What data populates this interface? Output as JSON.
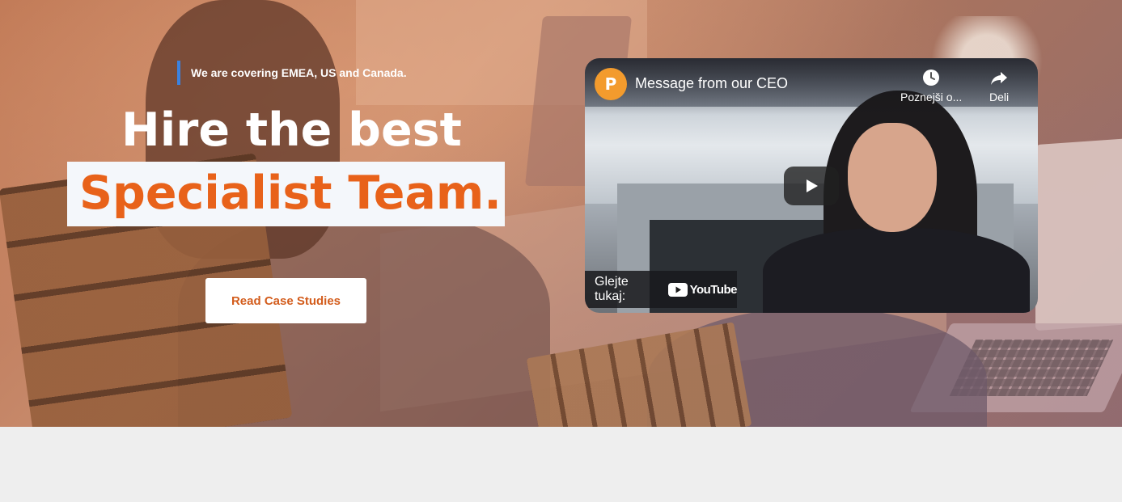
{
  "hero": {
    "tagline": "We are covering EMEA, US and Canada.",
    "headline_line1": "Hire the best",
    "headline_line2": "Specialist Team.",
    "cta_label": "Read Case Studies"
  },
  "video": {
    "channel_logo_letter": "P",
    "title": "Message from our CEO",
    "watch_later_label": "Poznejši o...",
    "share_label": "Deli",
    "watch_on_label": "Glejte tukaj:",
    "platform_label": "YouTube"
  },
  "colors": {
    "accent_orange": "#e8621a",
    "tagline_bar": "#3b82e0",
    "logo_orange": "#f39b2d",
    "footer_bg": "#eeeeee"
  },
  "icons": [
    "clock-icon",
    "share-icon",
    "play-icon",
    "youtube-logo-icon"
  ]
}
